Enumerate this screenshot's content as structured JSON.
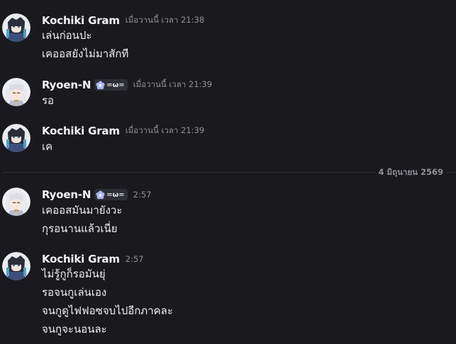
{
  "messages": [
    {
      "author": "Kochiki Gram",
      "avatar_icon": "kochiki-avatar",
      "timestamp": "เมื่อวานนี้ เวลา 21:38",
      "lines": [
        "เล่นก่อนปะ",
        "เคออสยังไม่มาสักที"
      ]
    },
    {
      "author": "Ryoen-N",
      "avatar_icon": "ryoen-avatar",
      "role_badge": "=ω=",
      "role_icon": "flower-icon",
      "timestamp": "เมื่อวานนี้ เวลา 21:39",
      "lines": [
        "รอ"
      ]
    },
    {
      "author": "Kochiki Gram",
      "avatar_icon": "kochiki-avatar",
      "timestamp": "เมื่อวานนี้ เวลา 21:39",
      "lines": [
        "เค"
      ]
    },
    {
      "author": "Ryoen-N",
      "avatar_icon": "ryoen-avatar",
      "role_badge": "=ω=",
      "role_icon": "flower-icon",
      "timestamp": "2:57",
      "lines": [
        "เคออสมันมายังวะ",
        "กุรอนานแล้วเนี่ย"
      ]
    },
    {
      "author": "Kochiki Gram",
      "avatar_icon": "kochiki-avatar",
      "timestamp": "2:57",
      "lines": [
        "ไม่รู้กูก็รอมันยุ่",
        "รอจนกูเล่นเอง",
        "จนกูดูไฟฟอซจบไปอีกภาคละ",
        "จนกูจะนอนละ"
      ]
    }
  ],
  "date_divider": "4 มิถุนายน 2569",
  "colors": {
    "background": "#1a1a1e",
    "username": "#f2f3f5",
    "timestamp": "#8e9297",
    "message_text": "#eceef0",
    "badge_bg": "#2e3035",
    "divider": "#2e2f34"
  }
}
